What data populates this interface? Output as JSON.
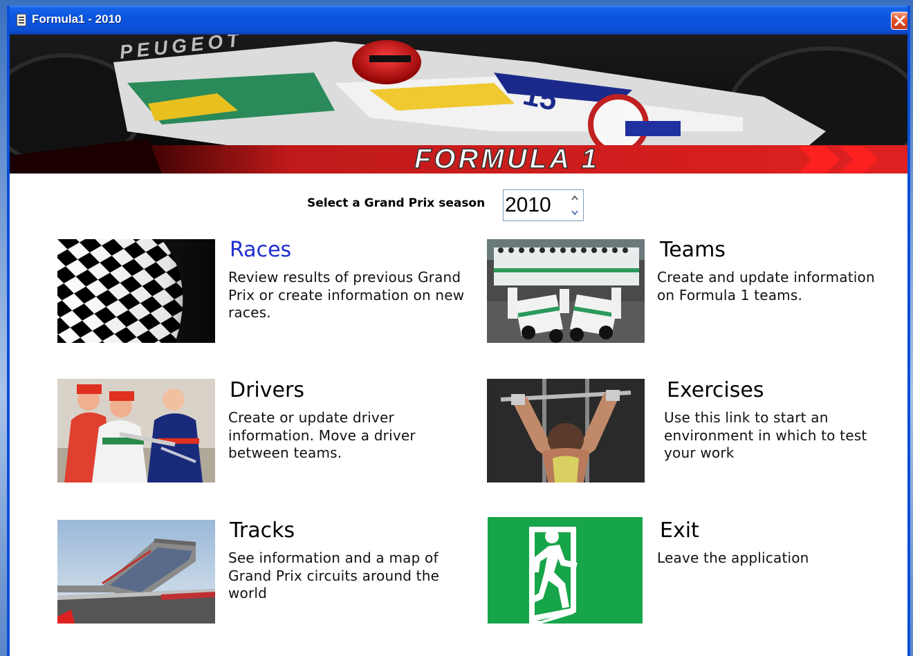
{
  "window": {
    "title": "Formula1 - 2010",
    "accent": "#0a55df",
    "close_color": "#e0502a"
  },
  "banner": {
    "logo_text": "FORMULA 1",
    "sponsor_text": "PEUGEOT",
    "car_number": "15"
  },
  "season": {
    "label": "Select a Grand Prix season",
    "value": "2010"
  },
  "tiles": {
    "races": {
      "title": "Races",
      "description": "Review results of previous Grand Prix or create information on new races.",
      "image": "checkered-flag-image"
    },
    "teams": {
      "title": "Teams",
      "description": "Create and update information on Formula 1 teams.",
      "image": "team-photo-image"
    },
    "drivers": {
      "title": "Drivers",
      "description": "Create or update driver information.  Move a driver between teams.",
      "image": "drivers-podium-image"
    },
    "exercises": {
      "title": "Exercises",
      "description": "Use this link to start an environment in which to test your work",
      "image": "weightlifter-image"
    },
    "tracks": {
      "title": "Tracks",
      "description": "See information and a map of Grand Prix circuits around the world",
      "image": "grandstand-image"
    },
    "exit": {
      "title": "Exit",
      "description": "Leave the application",
      "image": "exit-sign-image",
      "color": "#17a54a"
    }
  }
}
